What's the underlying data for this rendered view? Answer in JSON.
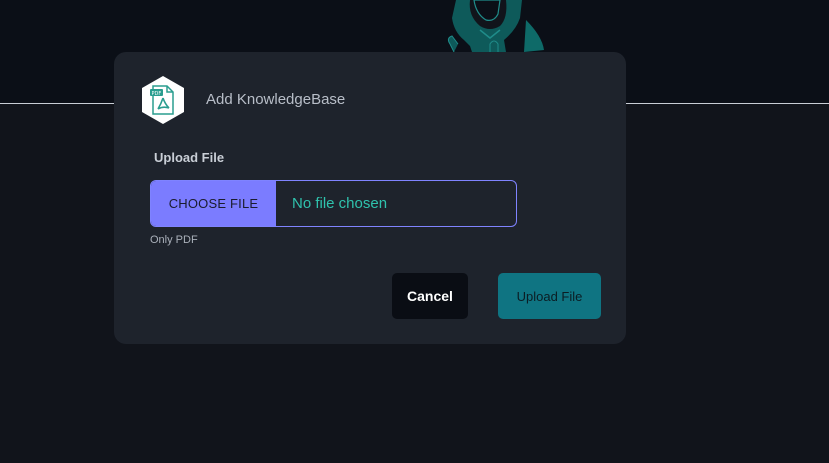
{
  "modal": {
    "title": "Add KnowledgeBase",
    "icon": "pdf-file-icon",
    "upload_label": "Upload File",
    "choose_file_label": "CHOOSE FILE",
    "file_status": "No file chosen",
    "helper_text": "Only PDF",
    "cancel_label": "Cancel",
    "upload_label_button": "Upload File"
  },
  "colors": {
    "accent": "#7b7cff",
    "teal": "#0f7482",
    "status_text": "#2fc2ad",
    "modal_bg": "#1e232c",
    "page_bg": "#11141b"
  }
}
